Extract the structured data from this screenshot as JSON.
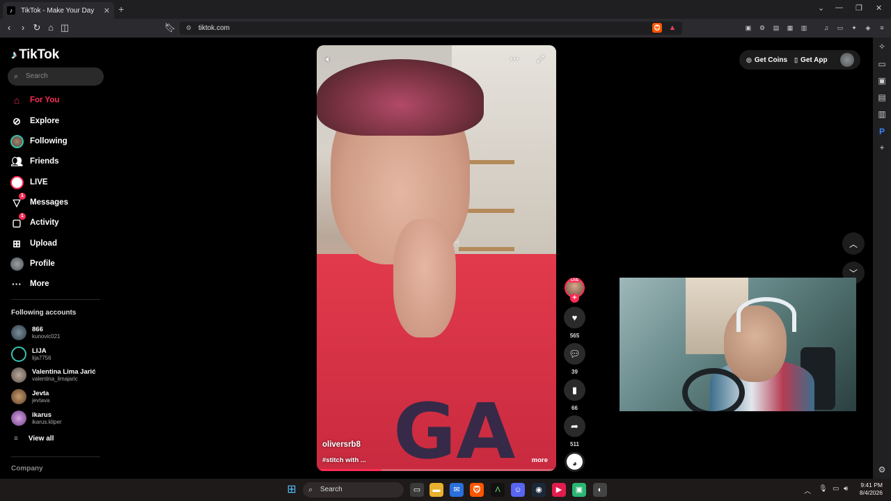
{
  "browser": {
    "tab_title": "TikTok - Make Your Day",
    "url": "tiktok.com",
    "new_tab": "+",
    "tab_close": "✕"
  },
  "tiktok": {
    "logo_text": "TikTok",
    "search_placeholder": "Search",
    "nav": [
      {
        "label": "For You",
        "icon": "home-icon"
      },
      {
        "label": "Explore",
        "icon": "compass-icon"
      },
      {
        "label": "Following",
        "icon": "following-avatar-icon"
      },
      {
        "label": "Friends",
        "icon": "friends-icon"
      },
      {
        "label": "LIVE",
        "icon": "live-icon"
      },
      {
        "label": "Messages",
        "icon": "messages-icon",
        "badge": "1"
      },
      {
        "label": "Activity",
        "icon": "activity-icon",
        "badge": "1"
      },
      {
        "label": "Upload",
        "icon": "upload-icon"
      },
      {
        "label": "Profile",
        "icon": "profile-avatar-icon"
      },
      {
        "label": "More",
        "icon": "more-icon"
      }
    ],
    "following_title": "Following accounts",
    "following": [
      {
        "name": "866",
        "handle": "kunovic021"
      },
      {
        "name": "LIJA",
        "handle": "lija7756"
      },
      {
        "name": "Valentina Lima Jarić",
        "handle": "valentina_limajaric"
      },
      {
        "name": "Jevta",
        "handle": "jevtava"
      },
      {
        "name": "ikarus",
        "handle": "ikarus.kliper"
      }
    ],
    "view_all": "View all",
    "company": "Company",
    "get_coins": "Get Coins",
    "get_app": "Get App"
  },
  "video": {
    "username": "oliversrb8",
    "caption": "#stitch with ...",
    "more": "more",
    "progress_percent": 27,
    "shirt_print": "GA",
    "live_tag": "LIVE",
    "likes": "565",
    "comments": "39",
    "saves": "66",
    "shares": "511"
  },
  "taskbar": {
    "search": "Search",
    "time": "9:41 PM",
    "date": "8/4/2026"
  },
  "colors": {
    "accent": "#fe2c55",
    "background": "#000000",
    "browser_toolbar": "#2b2b2f"
  }
}
